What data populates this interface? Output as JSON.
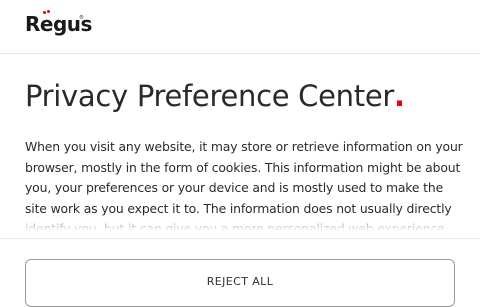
{
  "brand": {
    "logo_text": "Regus",
    "registered_mark": "®",
    "accent_color": "#e30613"
  },
  "modal": {
    "title": "Privacy Preference Center",
    "title_dot": ".",
    "description": "When you visit any website, it may store or retrieve information on your browser, mostly in the form of cookies. This information might be about you, your preferences or your device and is mostly used to make the site work as you expect it to. The information does not usually directly identify you, but it can give you a more personalized web experience."
  },
  "actions": {
    "reject_all_label": "REJECT ALL"
  }
}
